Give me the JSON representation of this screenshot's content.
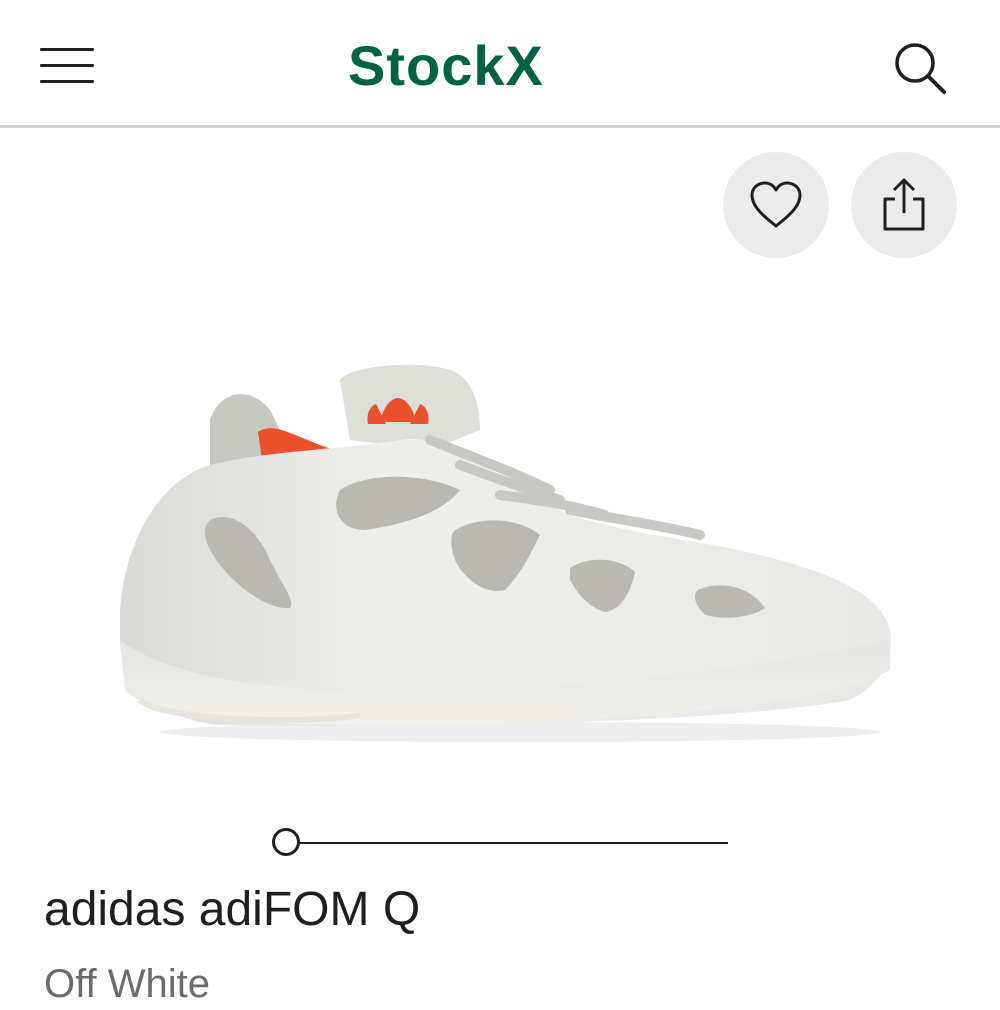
{
  "header": {
    "brand": "StockX",
    "menu_icon": "hamburger-menu-icon",
    "search_icon": "search-icon",
    "brand_color": "#006340"
  },
  "actions": {
    "favorite_icon": "heart-icon",
    "share_icon": "share-icon"
  },
  "product": {
    "name": "adidas adiFOM Q",
    "colorway": "Off White",
    "image_carousel_position": 0,
    "accent_color": "#e8512b"
  }
}
